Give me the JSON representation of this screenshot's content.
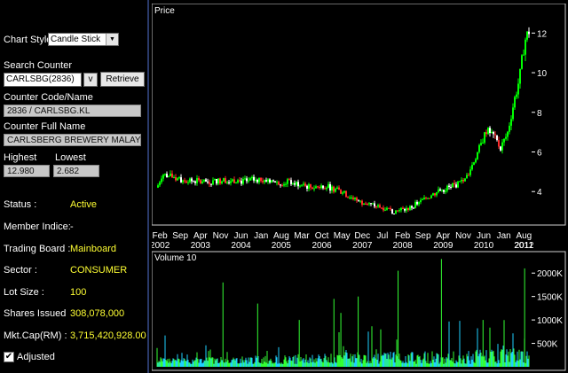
{
  "left": {
    "chart_style_label": "Chart Style:",
    "chart_style_value": "Candle Stick",
    "search_label": "Search Counter",
    "search_value": "CARLSBG(2836)",
    "search_v": "v",
    "retrieve": "Retrieve",
    "code_label": "Counter Code/Name",
    "code_value": "2836 / CARLSBG.KL",
    "fullname_label": "Counter Full Name",
    "fullname_value": "CARLSBERG BREWERY MALAYS",
    "highest_label": "Highest",
    "highest_value": "12.980",
    "lowest_label": "Lowest",
    "lowest_value": "2.682",
    "status_label": "Status :",
    "status_value": "Active",
    "member_label": "Member Indice:",
    "member_value": "-",
    "board_label": "Trading Board :",
    "board_value": "Mainboard",
    "sector_label": "Sector :",
    "sector_value": "CONSUMER",
    "lot_label": "Lot Size :",
    "lot_value": "100",
    "shares_label": "Shares Issued",
    "shares_value": "308,078,000",
    "mktcap_label": "Mkt.Cap(RM) :",
    "mktcap_value": "3,715,420,928.00",
    "adjusted_label": "Adjusted",
    "adjusted_check": "✔"
  },
  "colors": {
    "panel_border": "#2a3a6a",
    "plot_border": "#cfcfcf",
    "candle_up": "#00ff00",
    "candle_down": "#ff2a2a",
    "volume": "#33ff33",
    "volume_dense": "#1ed0ff",
    "value": "#ffff33"
  },
  "chart_data": [
    {
      "type": "line",
      "title": "Price",
      "ylim": [
        2.4,
        13.4
      ],
      "y_ticks": [
        4,
        6,
        8,
        10,
        12
      ],
      "y_tick_labels": [
        "4",
        "6",
        "8",
        "10",
        "12"
      ],
      "x_range": [
        2002.0,
        2012.75
      ],
      "x_tick_labels_top": [
        "Feb",
        "Sep",
        "Apr",
        "Nov",
        "Jun",
        "Jan",
        "Aug",
        "Mar",
        "Oct",
        "May",
        "Dec",
        "Jul",
        "Feb",
        "Sep",
        "Apr",
        "Nov",
        "Jun",
        "Jan",
        "Aug"
      ],
      "x_tick_labels_bottom": [
        "2002",
        "2003",
        "2004",
        "2005",
        "2006",
        "2007",
        "2008",
        "2009",
        "2010",
        "2011",
        "2012"
      ],
      "x_tick_positions": [
        2002.08,
        2002.67,
        2003.25,
        2003.83,
        2004.42,
        2005.0,
        2005.58,
        2006.17,
        2006.75,
        2007.33,
        2007.92,
        2008.5,
        2009.08,
        2009.67,
        2010.25,
        2010.83,
        2011.42,
        2012.0,
        2012.58
      ],
      "x_year_positions": [
        2002.08,
        2003.25,
        2004.42,
        2005.58,
        2006.75,
        2007.92,
        2009.08,
        2010.25,
        2011.42,
        2012.58,
        2012.58
      ],
      "series": [
        {
          "x": [
            2002.0,
            2002.15,
            2002.3,
            2002.5,
            2002.7,
            2002.9,
            2003.1,
            2003.3,
            2003.5,
            2003.8,
            2004.0,
            2004.3,
            2004.5,
            2004.8,
            2005.0,
            2005.3,
            2005.6,
            2005.9,
            2006.2,
            2006.5,
            2006.8,
            2007.0,
            2007.3,
            2007.6,
            2007.9,
            2008.2,
            2008.5,
            2008.8,
            2009.0,
            2009.2,
            2009.5,
            2009.8,
            2010.1,
            2010.4,
            2010.7,
            2010.9,
            2011.1,
            2011.3,
            2011.5,
            2011.7,
            2011.9,
            2012.1,
            2012.3,
            2012.45,
            2012.6,
            2012.75
          ],
          "y": [
            4.2,
            4.9,
            4.8,
            4.7,
            4.6,
            4.5,
            4.55,
            4.45,
            4.5,
            4.55,
            4.6,
            4.55,
            4.5,
            4.6,
            4.65,
            4.55,
            4.45,
            4.5,
            4.3,
            4.2,
            4.3,
            4.2,
            4.0,
            3.7,
            3.45,
            3.3,
            3.2,
            3.0,
            3.05,
            3.1,
            3.4,
            3.7,
            4.0,
            4.2,
            4.4,
            4.6,
            5.4,
            6.2,
            7.1,
            6.8,
            6.2,
            6.9,
            8.6,
            9.7,
            11.6,
            12.2
          ]
        }
      ]
    },
    {
      "type": "bar",
      "title": "Volume 10",
      "ylim": [
        0,
        2250000
      ],
      "y_ticks": [
        500000,
        1000000,
        1500000,
        2000000
      ],
      "y_tick_labels": [
        "500K",
        "1000K",
        "1500K",
        "2000K"
      ],
      "x_range": [
        2002.0,
        2012.75
      ],
      "spikes": [
        {
          "x": 2003.9,
          "value": 1800000
        },
        {
          "x": 2004.9,
          "value": 1350000
        },
        {
          "x": 2006.1,
          "value": 1000000
        },
        {
          "x": 2007.1,
          "value": 1450000
        },
        {
          "x": 2007.3,
          "value": 1150000
        },
        {
          "x": 2007.8,
          "value": 1500000
        },
        {
          "x": 2008.95,
          "value": 2050000
        },
        {
          "x": 2010.2,
          "value": 2300000
        },
        {
          "x": 2011.4,
          "value": 1000000
        },
        {
          "x": 2012.6,
          "value": 2100000
        }
      ]
    }
  ]
}
